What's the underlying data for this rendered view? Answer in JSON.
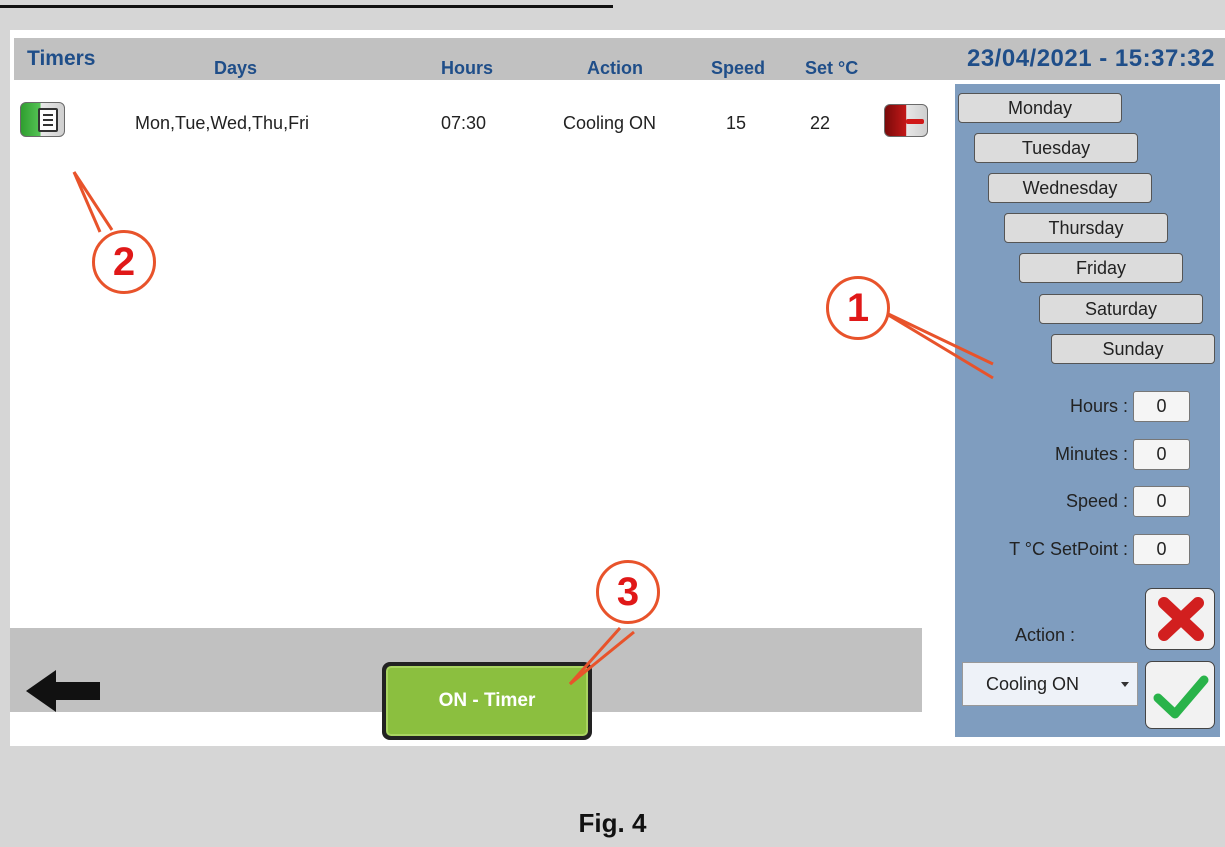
{
  "window": {
    "title": "Timers",
    "datetime": "23/04/2021 - 15:37:32"
  },
  "table": {
    "headers": {
      "days": "Days",
      "hours": "Hours",
      "action": "Action",
      "speed": "Speed",
      "setpoint": "Set °C"
    },
    "rows": [
      {
        "days": "Mon,Tue,Wed,Thu,Fri",
        "hours": "07:30",
        "action": "Cooling ON",
        "speed": "15",
        "setpoint": "22"
      }
    ]
  },
  "days": [
    "Monday",
    "Tuesday",
    "Wednesday",
    "Thursday",
    "Friday",
    "Saturday",
    "Sunday"
  ],
  "fields": {
    "hours_label": "Hours :",
    "hours_value": "0",
    "minutes_label": "Minutes :",
    "minutes_value": "0",
    "speed_label": "Speed :",
    "speed_value": "0",
    "setpoint_label": "T °C SetPoint :",
    "setpoint_value": "0",
    "action_label": "Action :",
    "action_value": "Cooling ON"
  },
  "bottom": {
    "on_timer_label": "ON - Timer"
  },
  "callouts": [
    "1",
    "2",
    "3"
  ],
  "caption": "Fig. 4",
  "colors": {
    "header_text": "#1f4e89",
    "side_panel": "#7f9dbf",
    "on_timer": "#8bbf3f",
    "callout": "#e8532b"
  },
  "icons": [
    "edit-icon",
    "delete-icon",
    "back-arrow-icon",
    "cancel-icon",
    "confirm-icon",
    "dropdown-caret-icon"
  ]
}
